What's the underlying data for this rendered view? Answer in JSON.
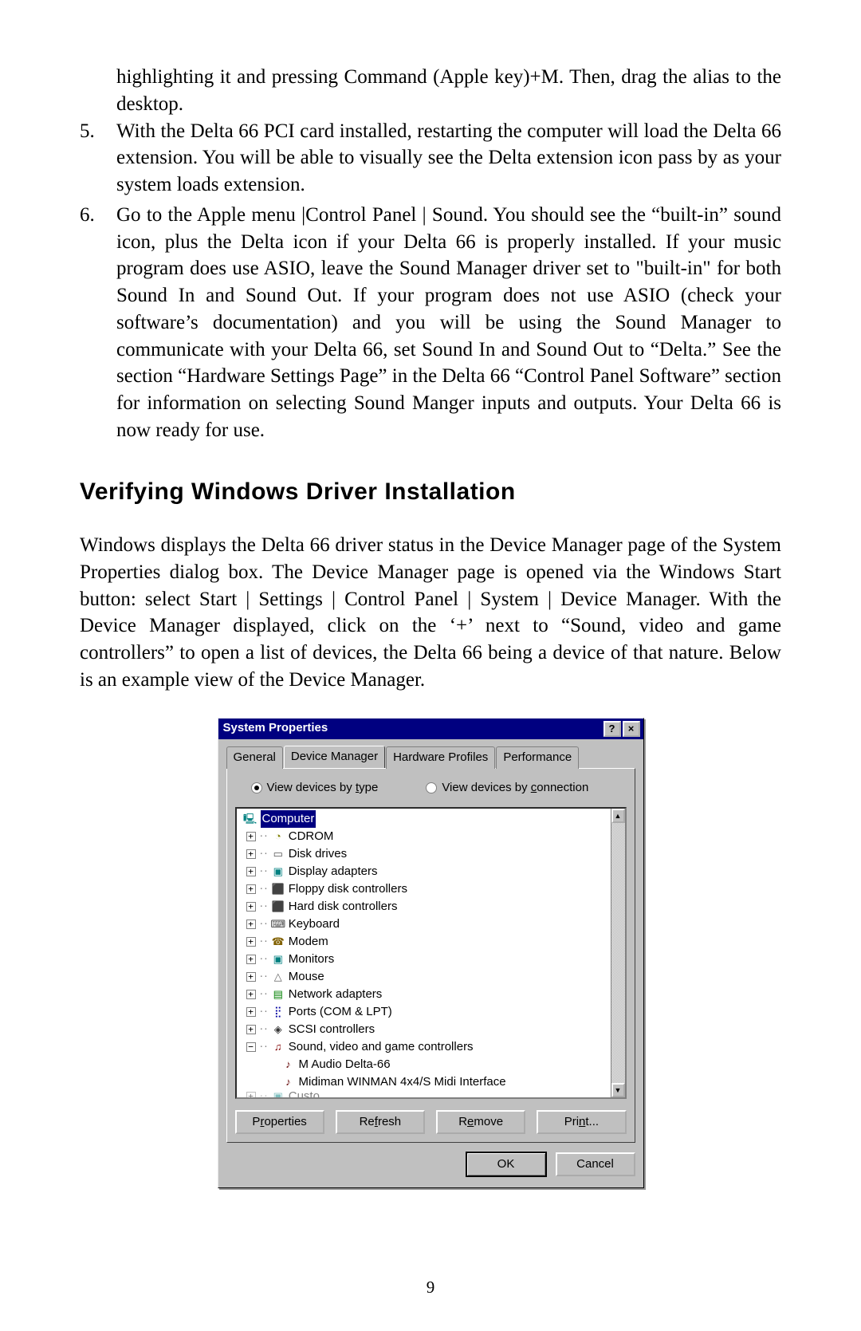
{
  "intro_para": "highlighting it and pressing Command (Apple key)+M.  Then, drag the alias to the desktop.",
  "list": [
    {
      "num": "5.",
      "text": "With the Delta 66 PCI card installed, restarting the computer will load the Delta 66 extension. You will be able to visually see the Delta extension icon pass by as your system loads extension."
    },
    {
      "num": "6.",
      "text": "Go to the Apple menu |Control Panel | Sound. You should see the “built-in” sound icon, plus the Delta icon if your Delta 66 is properly installed. If your music program does use ASIO, leave the Sound Manager driver set to \"built-in\" for both Sound In and Sound Out. If your program does not use ASIO (check your software’s documentation) and you will be using the Sound Manager to communicate with your Delta 66, set Sound In and Sound Out to “Delta.” See the section “Hardware Settings Page” in the Delta 66 “Control Panel Software” section for information on selecting Sound Manger inputs and outputs. Your Delta 66 is now ready for use."
    }
  ],
  "heading": "Verifying Windows Driver Installation",
  "body_para": "Windows displays the Delta 66 driver status in the Device Manager page of the System Properties dialog box.  The Device Manager page is opened via the Windows Start button: select Start | Settings | Control Panel | System | Device Manager.  With the Device Manager displayed, click on the ‘+’ next to “Sound, video and game controllers” to open a list of devices, the Delta 66 being a device of that nature.  Below is an example view of the Device Manager.",
  "dialog": {
    "title": "System Properties",
    "help": "?",
    "close": "×",
    "tabs": [
      "General",
      "Device Manager",
      "Hardware Profiles",
      "Performance"
    ],
    "active_tab": 1,
    "radio1_pre": "View devices by ",
    "radio1_u": "t",
    "radio1_post": "ype",
    "radio2_pre": "View devices by ",
    "radio2_u": "c",
    "radio2_post": "onnection",
    "tree": {
      "root": "Computer",
      "nodes": [
        {
          "label": "CDROM",
          "icon": "disc",
          "glyph": "◔",
          "exp": "+"
        },
        {
          "label": "Disk drives",
          "icon": "drive",
          "glyph": "▭",
          "exp": "+"
        },
        {
          "label": "Display adapters",
          "icon": "monitor",
          "glyph": "▣",
          "exp": "+"
        },
        {
          "label": "Floppy disk controllers",
          "icon": "drive",
          "glyph": "⬛",
          "exp": "+"
        },
        {
          "label": "Hard disk controllers",
          "icon": "drive",
          "glyph": "⬛",
          "exp": "+"
        },
        {
          "label": "Keyboard",
          "icon": "kbd",
          "glyph": "⌨",
          "exp": "+"
        },
        {
          "label": "Modem",
          "icon": "modem",
          "glyph": "☎",
          "exp": "+"
        },
        {
          "label": "Monitors",
          "icon": "monitor",
          "glyph": "▣",
          "exp": "+"
        },
        {
          "label": "Mouse",
          "icon": "mouse",
          "glyph": "△",
          "exp": "+"
        },
        {
          "label": "Network adapters",
          "icon": "net",
          "glyph": "▤",
          "exp": "+"
        },
        {
          "label": "Ports (COM & LPT)",
          "icon": "port",
          "glyph": "⣟",
          "exp": "+"
        },
        {
          "label": "SCSI controllers",
          "icon": "scsi",
          "glyph": "◈",
          "exp": "+"
        },
        {
          "label": "Sound, video and game controllers",
          "icon": "sound",
          "glyph": "♫",
          "exp": "−",
          "children": [
            {
              "label": "M Audio Delta-66",
              "icon": "sub",
              "glyph": "♪"
            },
            {
              "label": "Midiman WINMAN 4x4/S Midi Interface",
              "icon": "sub",
              "glyph": "♪"
            }
          ]
        }
      ],
      "cutoff_prefix": "Custo",
      "cutoff_label": "m devices"
    },
    "buttons": {
      "properties_pre": "P",
      "properties_u": "r",
      "properties_post": "operties",
      "refresh_pre": "Re",
      "refresh_u": "f",
      "refresh_post": "resh",
      "remove_pre": "R",
      "remove_u": "e",
      "remove_post": "move",
      "print_pre": "Pri",
      "print_u": "n",
      "print_post": "t..."
    },
    "ok": "OK",
    "cancel": "Cancel"
  },
  "page_number": "9"
}
